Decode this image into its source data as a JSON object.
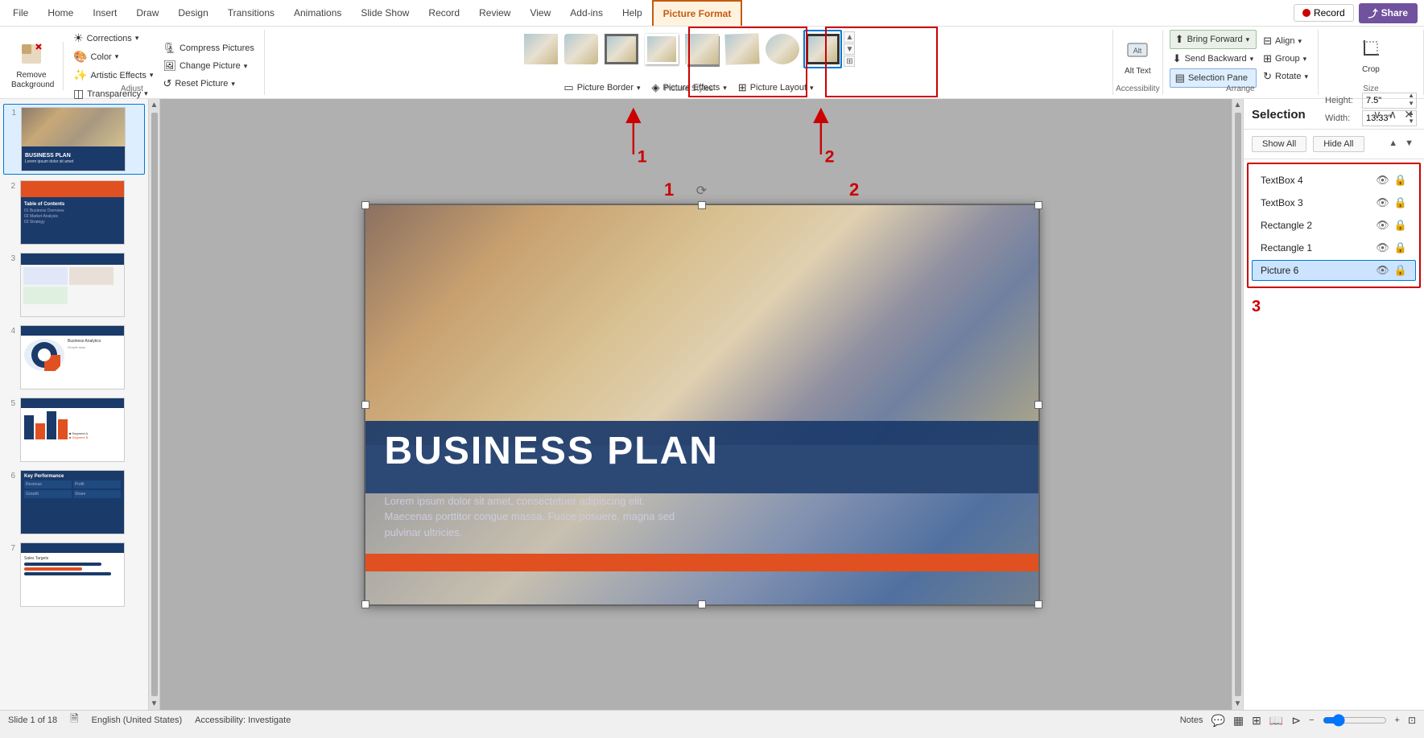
{
  "tabs": {
    "items": [
      {
        "label": "File",
        "active": false
      },
      {
        "label": "Home",
        "active": false
      },
      {
        "label": "Insert",
        "active": false
      },
      {
        "label": "Draw",
        "active": false
      },
      {
        "label": "Design",
        "active": false
      },
      {
        "label": "Transitions",
        "active": false
      },
      {
        "label": "Animations",
        "active": false
      },
      {
        "label": "Slide Show",
        "active": false
      },
      {
        "label": "Record",
        "active": false
      },
      {
        "label": "Review",
        "active": false
      },
      {
        "label": "View",
        "active": false
      },
      {
        "label": "Add-ins",
        "active": false
      },
      {
        "label": "Help",
        "active": false
      },
      {
        "label": "Picture Format",
        "active": true
      }
    ],
    "record_btn": "Record",
    "share_btn": "Share"
  },
  "ribbon": {
    "adjust_group_label": "Adjust",
    "picture_styles_label": "Picture Styles",
    "accessibility_label": "Accessibility",
    "arrange_label": "Arrange",
    "size_label": "Size",
    "remove_bg": "Remove Background",
    "corrections": "Corrections",
    "color": "Color",
    "artistic_effects": "Artistic Effects",
    "transparency": "Transparency",
    "compress_pictures": "Compress Pictures",
    "change_picture": "Change Picture",
    "reset_picture": "Reset Picture",
    "picture_border": "Picture Border",
    "picture_effects": "Picture Effects",
    "picture_layout": "Picture Layout",
    "alt_text": "Alt Text",
    "bring_forward": "Bring Forward",
    "send_backward": "Send Backward",
    "selection_pane": "Selection Pane",
    "align": "Align",
    "group": "Group",
    "rotate": "Rotate",
    "crop": "Crop",
    "height_label": "Height:",
    "height_value": "7.5\"",
    "width_label": "Width:",
    "width_value": "13.33\""
  },
  "selection_pane": {
    "title": "Selection",
    "show_all": "Show All",
    "hide_all": "Hide All",
    "items": [
      {
        "name": "TextBox 4",
        "selected": false
      },
      {
        "name": "TextBox 3",
        "selected": false
      },
      {
        "name": "Rectangle 2",
        "selected": false
      },
      {
        "name": "Rectangle 1",
        "selected": false
      },
      {
        "name": "Picture 6",
        "selected": true
      }
    ]
  },
  "slide": {
    "title": "BUSINESS PLAN",
    "subtitle": "Lorem ipsum dolor sit amet, consectetuer adipiscing elit. Maecenas porttitor congue massa. Fusce posuere, magna sed pulvinar ultricies."
  },
  "annotations": {
    "num1": "1",
    "num2": "2",
    "num3": "3"
  },
  "status_bar": {
    "slide_info": "Slide 1 of 18",
    "language": "English (United States)",
    "accessibility": "Accessibility: Investigate",
    "notes": "Notes",
    "zoom_value": "‒"
  },
  "sidebar": {
    "slides": [
      {
        "num": "1"
      },
      {
        "num": "2"
      },
      {
        "num": "3"
      },
      {
        "num": "4"
      },
      {
        "num": "5"
      },
      {
        "num": "6"
      },
      {
        "num": "7"
      }
    ]
  }
}
